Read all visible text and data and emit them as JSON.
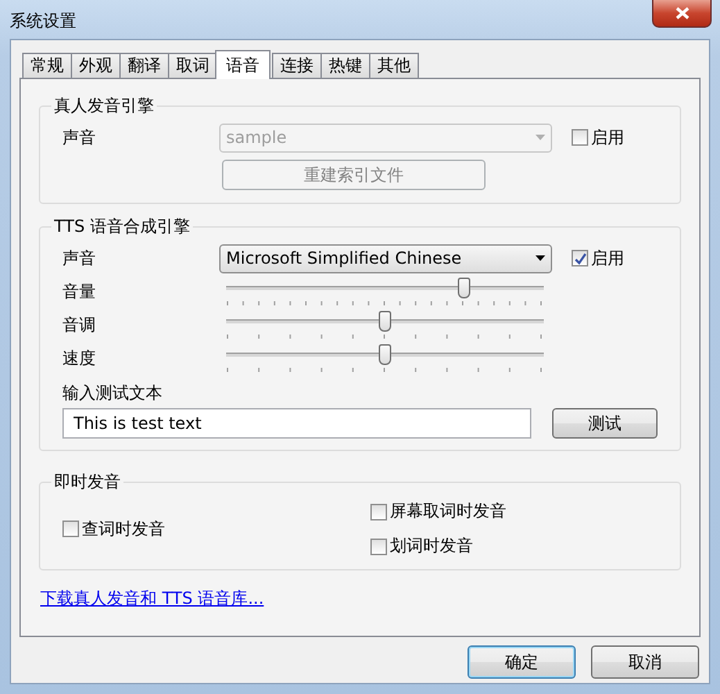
{
  "window": {
    "title": "系统设置"
  },
  "tabs": [
    {
      "label": "常规",
      "selected": false
    },
    {
      "label": "外观",
      "selected": false
    },
    {
      "label": "翻译",
      "selected": false
    },
    {
      "label": "取词",
      "selected": false
    },
    {
      "label": "语音",
      "selected": true
    },
    {
      "label": "连接",
      "selected": false
    },
    {
      "label": "热键",
      "selected": false
    },
    {
      "label": "其他",
      "selected": false
    }
  ],
  "human_engine": {
    "title": "真人发音引擎",
    "voice_label": "声音",
    "voice_value": "sample",
    "voice_disabled": true,
    "enable_label": "启用",
    "enable_checked": false,
    "rebuild_button": {
      "label": "重建索引文件",
      "disabled": true
    }
  },
  "tts_engine": {
    "title": "TTS 语音合成引擎",
    "voice_label": "声音",
    "voice_value": "Microsoft Simplified Chinese",
    "voice_disabled": false,
    "enable_label": "启用",
    "enable_checked": true,
    "sliders": [
      {
        "label": "音量",
        "level": 0.75,
        "kind": "fine"
      },
      {
        "label": "音调",
        "level": 0.5,
        "kind": "coarse"
      },
      {
        "label": "速度",
        "level": 0.5,
        "kind": "coarse"
      }
    ],
    "test_label": "输入测试文本",
    "test_value": "This is test text",
    "test_button": "测试"
  },
  "instant": {
    "title": "即时发音",
    "left_options": [
      {
        "label": "查词时发音",
        "checked": false
      }
    ],
    "right_options": [
      {
        "label": "屏幕取词时发音",
        "checked": false
      },
      {
        "label": "划词时发音",
        "checked": false
      }
    ]
  },
  "download_link": "下载真人发音和 TTS 语音库...",
  "buttons": [
    {
      "label": "确定",
      "default": true
    },
    {
      "label": "取消",
      "default": false
    }
  ]
}
